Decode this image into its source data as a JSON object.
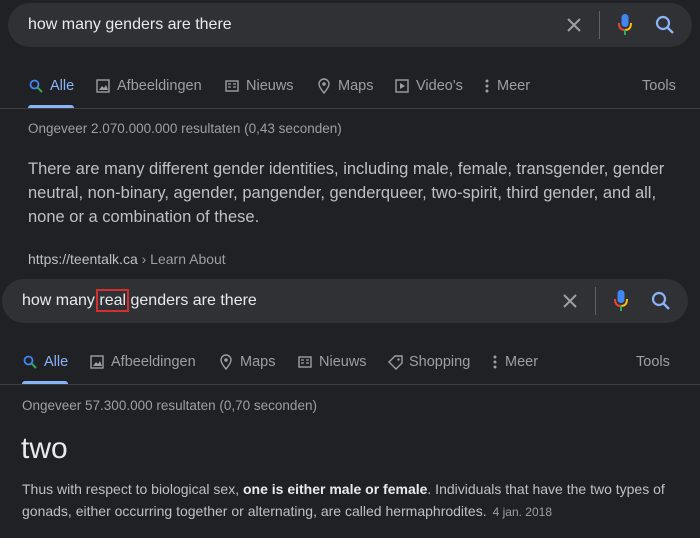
{
  "first": {
    "query": "how many genders are there",
    "tabs": [
      "Alle",
      "Afbeeldingen",
      "Nieuws",
      "Maps",
      "Video's",
      "Meer"
    ],
    "tools": "Tools",
    "stats": "Ongeveer 2.070.000.000 resultaten (0,43 seconden)",
    "snippet": "There are many different gender identities, including male, female, transgender, gender neutral, non-binary, agender, pangender, genderqueer, two-spirit, third gender, and all, none or a combination of these.",
    "url_domain": "https://teentalk.ca",
    "url_crumb": "› Learn About"
  },
  "second": {
    "query_before": "how many ",
    "query_highlight": "real",
    "query_after": " genders are there",
    "tabs": [
      "Alle",
      "Afbeeldingen",
      "Maps",
      "Nieuws",
      "Shopping",
      "Meer"
    ],
    "tools": "Tools",
    "stats": "Ongeveer 57.300.000 resultaten (0,70 seconden)",
    "answer": "two",
    "text_before": "Thus with respect to biological sex, ",
    "text_bold": "one is either male or female",
    "text_after": ". Individuals that have the two types of gonads, either occurring together or alternating, are called hermaphrodites.",
    "date": "4 jan. 2018"
  },
  "colors": {
    "background": "#202124",
    "search_bar": "#303134",
    "accent": "#8ab4f8",
    "highlight_box": "#d32f2f"
  }
}
